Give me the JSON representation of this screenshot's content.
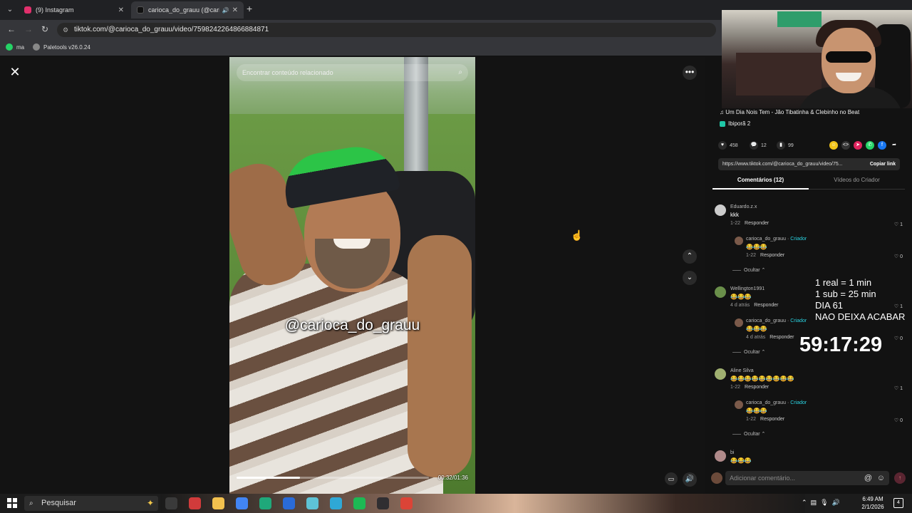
{
  "browser": {
    "tabs": [
      {
        "title": "(9) Instagram",
        "color": "#e1306c"
      },
      {
        "title": "carioca_do_grauu (@carioca",
        "color": "#111111"
      }
    ],
    "url": "tiktok.com/@carioca_do_grauu/video/7598242264866884871",
    "bookmarks": [
      {
        "label": "ma",
        "color": "#25d366"
      },
      {
        "label": "Paletools v26.0.24",
        "color": "#888888"
      }
    ]
  },
  "video": {
    "search_placeholder": "Encontrar conteúdo relacionado",
    "handle": "@carioca_do_grauu",
    "time": "00:32/01:36",
    "progress": 0.33
  },
  "panel": {
    "song": "♫ Um Dia Nois Tem - Jão Tibatinha & Clebinho no Beat",
    "creator": "Ibiporã",
    "creator_count": "2",
    "likes": "458",
    "comments": "12",
    "saves": "99",
    "link": "https://www.tiktok.com/@carioca_do_grauu/video/75...",
    "copy_label": "Copiar link",
    "tab_comments": "Comentários (12)",
    "tab_creator": "Vídeos do Criador",
    "comments_list": [
      {
        "name": "Eduardo.z.x",
        "body": "kkk",
        "date": "1-22",
        "likes": "1",
        "avatar": "#cccccc",
        "creator": false,
        "reply": true
      },
      {
        "name": "carioca_do_grauu · ",
        "tag": "Criador",
        "body": "😂😂😂",
        "date": "1-22",
        "likes": "0",
        "avatar": "#7b5a4a",
        "creator": true,
        "reply": false
      },
      {
        "name": "Wellington1991",
        "body": "😂😂😂",
        "date": "4 d atrás",
        "likes": "1",
        "avatar": "#6a8f4a",
        "creator": false,
        "reply": true
      },
      {
        "name": "carioca_do_grauu · ",
        "tag": "Criador",
        "body": "😂😂😂",
        "date": "4 d atrás",
        "likes": "0",
        "avatar": "#7b5a4a",
        "creator": true,
        "reply": false
      },
      {
        "name": "Aline Silva",
        "body": "😂😂😂😂😂😂😂😂😂",
        "date": "1-22",
        "likes": "1",
        "avatar": "#a0b070",
        "creator": false,
        "reply": true
      },
      {
        "name": "carioca_do_grauu · ",
        "tag": "Criador",
        "body": "😂😂😂",
        "date": "1-22",
        "likes": "0",
        "avatar": "#7b5a4a",
        "creator": true,
        "reply": false
      },
      {
        "name": "bi",
        "body": "😂😂😂",
        "date": "",
        "likes": "",
        "avatar": "#b08a8a",
        "creator": false,
        "reply": false
      }
    ],
    "reply_label": "Responder",
    "hide_label": "Ocultar ⌃",
    "comment_placeholder": "Adicionar comentário..."
  },
  "overlay": {
    "lines": "1 real = 1 min\n1 sub = 25 min\nDIA 61\nNAO DEIXA ACABAR",
    "timer": "59:17:29"
  },
  "taskbar": {
    "search": "Pesquisar",
    "time": "6:49 AM",
    "date": "2/1/2026",
    "notif": "4",
    "apps": [
      {
        "name": "task-view",
        "color": "#3a3a3a"
      },
      {
        "name": "app-red",
        "color": "#d13b3b"
      },
      {
        "name": "file-explorer",
        "color": "#f2c14e"
      },
      {
        "name": "chrome",
        "color": "#4285f4"
      },
      {
        "name": "app-teal",
        "color": "#1fa87a"
      },
      {
        "name": "store",
        "color": "#2a6bd8"
      },
      {
        "name": "app-notes",
        "color": "#5ec3d6"
      },
      {
        "name": "edge",
        "color": "#2fa8d6"
      },
      {
        "name": "spotify",
        "color": "#1db954"
      },
      {
        "name": "app-obs",
        "color": "#302e31"
      },
      {
        "name": "chrome-active",
        "color": "#db4437"
      }
    ]
  }
}
